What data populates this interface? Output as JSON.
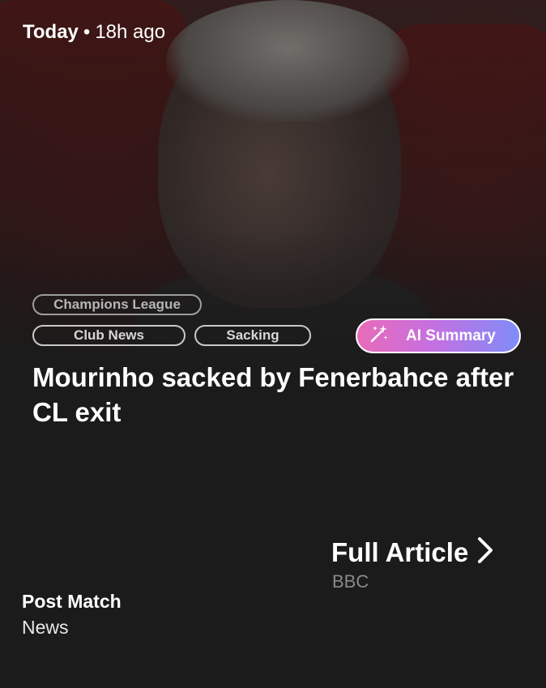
{
  "meta": {
    "day": "Today",
    "separator": "•",
    "age": "18h ago"
  },
  "tags": {
    "competition": "Champions League",
    "items": [
      "Club News",
      "Sacking"
    ]
  },
  "ai_summary": {
    "label": "AI Summary",
    "icon": "magic-wand-icon"
  },
  "headline": "Mourinho sacked by Fenerbahce after CL exit",
  "full_article": {
    "label": "Full Article",
    "icon": "chevron-right-icon"
  },
  "source": "BBC",
  "category": {
    "primary": "Post Match",
    "secondary": "News"
  },
  "colors": {
    "background": "#1b1b1b",
    "ai_gradient_start": "#e86bb7",
    "ai_gradient_end": "#7f8cf8"
  }
}
